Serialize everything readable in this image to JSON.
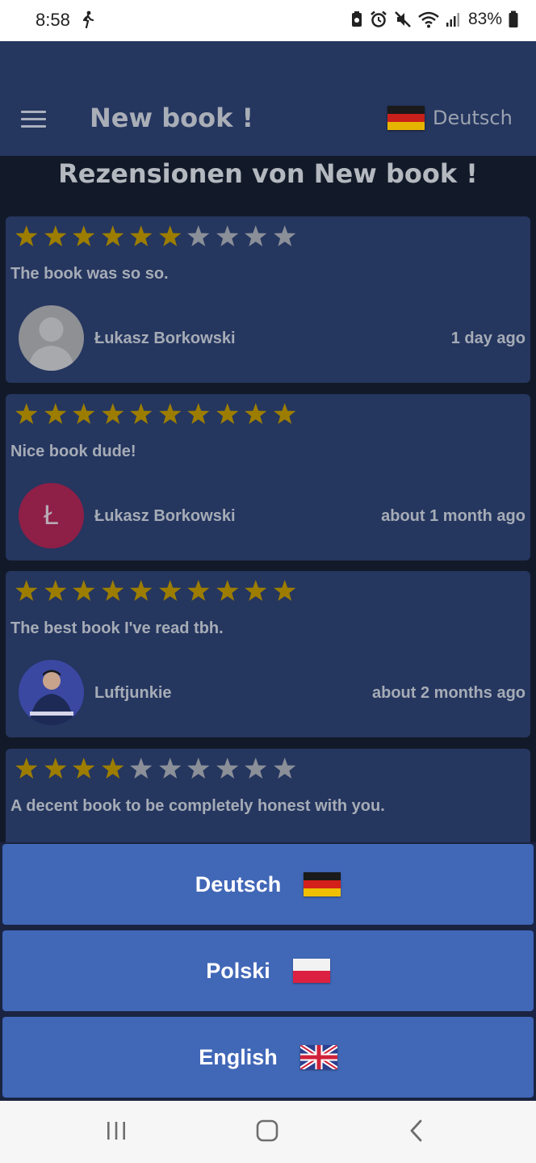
{
  "status_bar": {
    "time": "8:58",
    "battery": "83%",
    "icons": [
      "walking-icon",
      "battery-saver-icon",
      "alarm-icon",
      "mute-icon",
      "wifi-icon",
      "signal-icon",
      "battery-icon"
    ]
  },
  "app_bar": {
    "title": "New book !",
    "menu_icon": "hamburger-menu-icon",
    "current_language": "Deutsch",
    "current_language_flag": "german-flag-icon"
  },
  "reviews_heading": "Rezensionen von New book !",
  "colors": {
    "background": "#121a29",
    "card": "#25365f",
    "star_filled": "#9c7d00",
    "star_empty": "#8a8f98",
    "sheet_button": "#4167b7"
  },
  "reviews": [
    {
      "rating": 6,
      "max_rating": 10,
      "text": "The book was so so.",
      "author": "Łukasz Borkowski",
      "date": "1 day ago",
      "avatar": "default-avatar-icon"
    },
    {
      "rating": 10,
      "max_rating": 10,
      "text": "Nice book dude!",
      "author": "Łukasz Borkowski",
      "date": "about 1 month ago",
      "avatar_letter": "Ł"
    },
    {
      "rating": 10,
      "max_rating": 10,
      "text": "The best book I've read tbh.",
      "author": "Luftjunkie",
      "date": "about 2 months ago",
      "avatar": "profile-photo"
    },
    {
      "rating": 4,
      "max_rating": 10,
      "text": "A decent book to be completely honest with you."
    }
  ],
  "language_sheet": {
    "options": [
      {
        "label": "Deutsch",
        "flag": "german-flag-icon"
      },
      {
        "label": "Polski",
        "flag": "polish-flag-icon"
      },
      {
        "label": "English",
        "flag": "uk-flag-icon"
      }
    ]
  },
  "nav_bar": {
    "buttons": [
      "recent-apps-icon",
      "home-icon",
      "back-icon"
    ]
  }
}
